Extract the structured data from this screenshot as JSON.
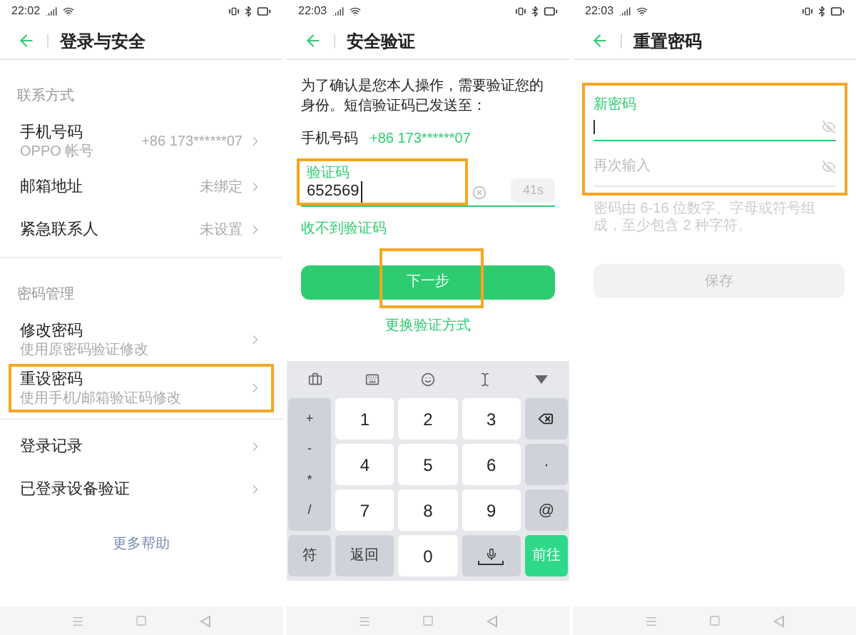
{
  "login_security": {
    "status_bar": {
      "time": "22:02"
    },
    "title": "登录与安全",
    "groups": [
      {
        "title": "联系方式",
        "items": [
          {
            "label": "手机号码",
            "sublabel": "OPPO 帐号",
            "value": "+86 173******07",
            "highlighted": false
          },
          {
            "label": "邮箱地址",
            "value": "未绑定",
            "highlighted": false
          },
          {
            "label": "紧急联系人",
            "value": "未设置",
            "highlighted": false
          }
        ]
      },
      {
        "title": "密码管理",
        "items": [
          {
            "label": "修改密码",
            "sublabel": "使用原密码验证修改",
            "highlighted": false
          },
          {
            "label": "重设密码",
            "sublabel": "使用手机/邮箱验证码修改",
            "highlighted": true
          }
        ]
      },
      {
        "items": [
          {
            "label": "登录记录",
            "highlighted": false
          },
          {
            "label": "已登录设备验证",
            "highlighted": false
          }
        ]
      }
    ],
    "help_link": "更多帮助"
  },
  "verification": {
    "status_bar": {
      "time": "22:03"
    },
    "title": "安全验证",
    "intro": "为了确认是您本人操作，需要验证您的身份。短信验证码已发送至：",
    "phone_label": "手机号码",
    "phone_value": "+86 173******07",
    "code_field": {
      "label": "验证码",
      "value": "652569",
      "countdown": "41s",
      "highlighted": true
    },
    "resend_link": "收不到验证码",
    "next_button": {
      "label": "下一步",
      "highlighted": true
    },
    "switch_link": "更换验证方式",
    "keyboard": {
      "side_symbols": [
        "+",
        "-",
        "*",
        "/"
      ],
      "digits": [
        "1",
        "2",
        "3",
        "4",
        "5",
        "6",
        "7",
        "8",
        "9"
      ],
      "right_keys": [
        {
          "kind": "backspace"
        },
        {
          "kind": "text",
          "label": "·"
        },
        {
          "kind": "text",
          "label": "@"
        }
      ],
      "bottom_keys": [
        {
          "kind": "function",
          "label": "符"
        },
        {
          "kind": "function",
          "label": "返回"
        },
        {
          "kind": "digit",
          "label": "0"
        },
        {
          "kind": "voice"
        },
        {
          "kind": "action",
          "label": "前往"
        }
      ]
    }
  },
  "reset_password": {
    "status_bar": {
      "time": "22:03"
    },
    "title": "重置密码",
    "fields_highlighted": true,
    "new_password": {
      "label": "新密码"
    },
    "confirm_password": {
      "placeholder": "再次输入"
    },
    "hint": "密码由 6-16 位数字、字母或符号组成，至少包含 2 种字符。",
    "save_button": {
      "label": "保存",
      "disabled": true
    }
  }
}
